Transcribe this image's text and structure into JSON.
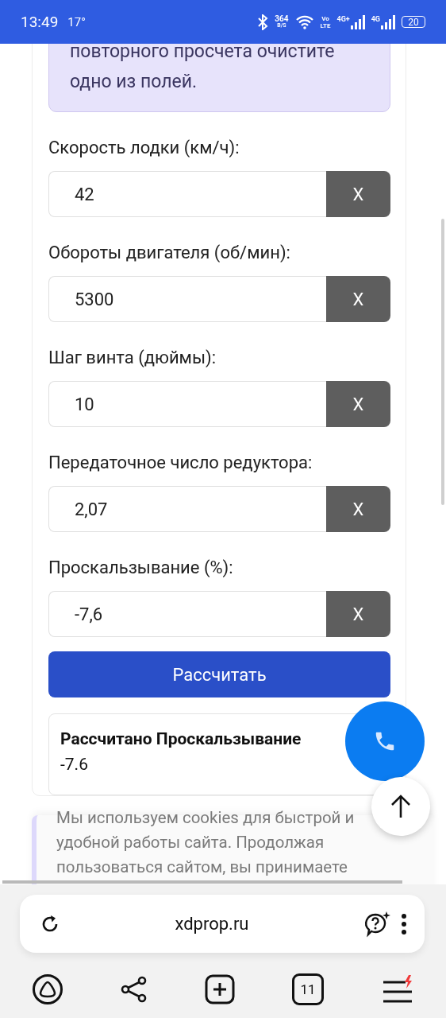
{
  "status_bar": {
    "time": "13:49",
    "temperature": "17°",
    "net_speed": "364",
    "net_speed_unit": "B/S",
    "volte_top": "Vo",
    "volte_bottom": "LTE",
    "signal_1": "4G+",
    "signal_2": "4G",
    "battery": "20"
  },
  "note": {
    "text": "повторного просчета очистите одно из полей."
  },
  "fields": [
    {
      "label": "Скорость лодки (км/ч):",
      "value": "42",
      "clear": "X"
    },
    {
      "label": "Обороты двигателя (об/мин):",
      "value": "5300",
      "clear": "X"
    },
    {
      "label": "Шаг винта (дюймы):",
      "value": "10",
      "clear": "X"
    },
    {
      "label": "Передаточное число редуктора:",
      "value": "2,07",
      "clear": "X"
    },
    {
      "label": "Проскальзывание (%):",
      "value": "-7,6",
      "clear": "X"
    }
  ],
  "calculate_button": "Рассчитать",
  "result": {
    "title": "Рассчитано Проскальзывание",
    "value": "-7.6"
  },
  "cookie_banner": {
    "text": "Мы используем cookies для быстрой и удобной работы сайта. Продолжая пользоваться сайтом, вы принимаете"
  },
  "browser": {
    "url": "xdprop.ru",
    "tab_count": "11"
  }
}
